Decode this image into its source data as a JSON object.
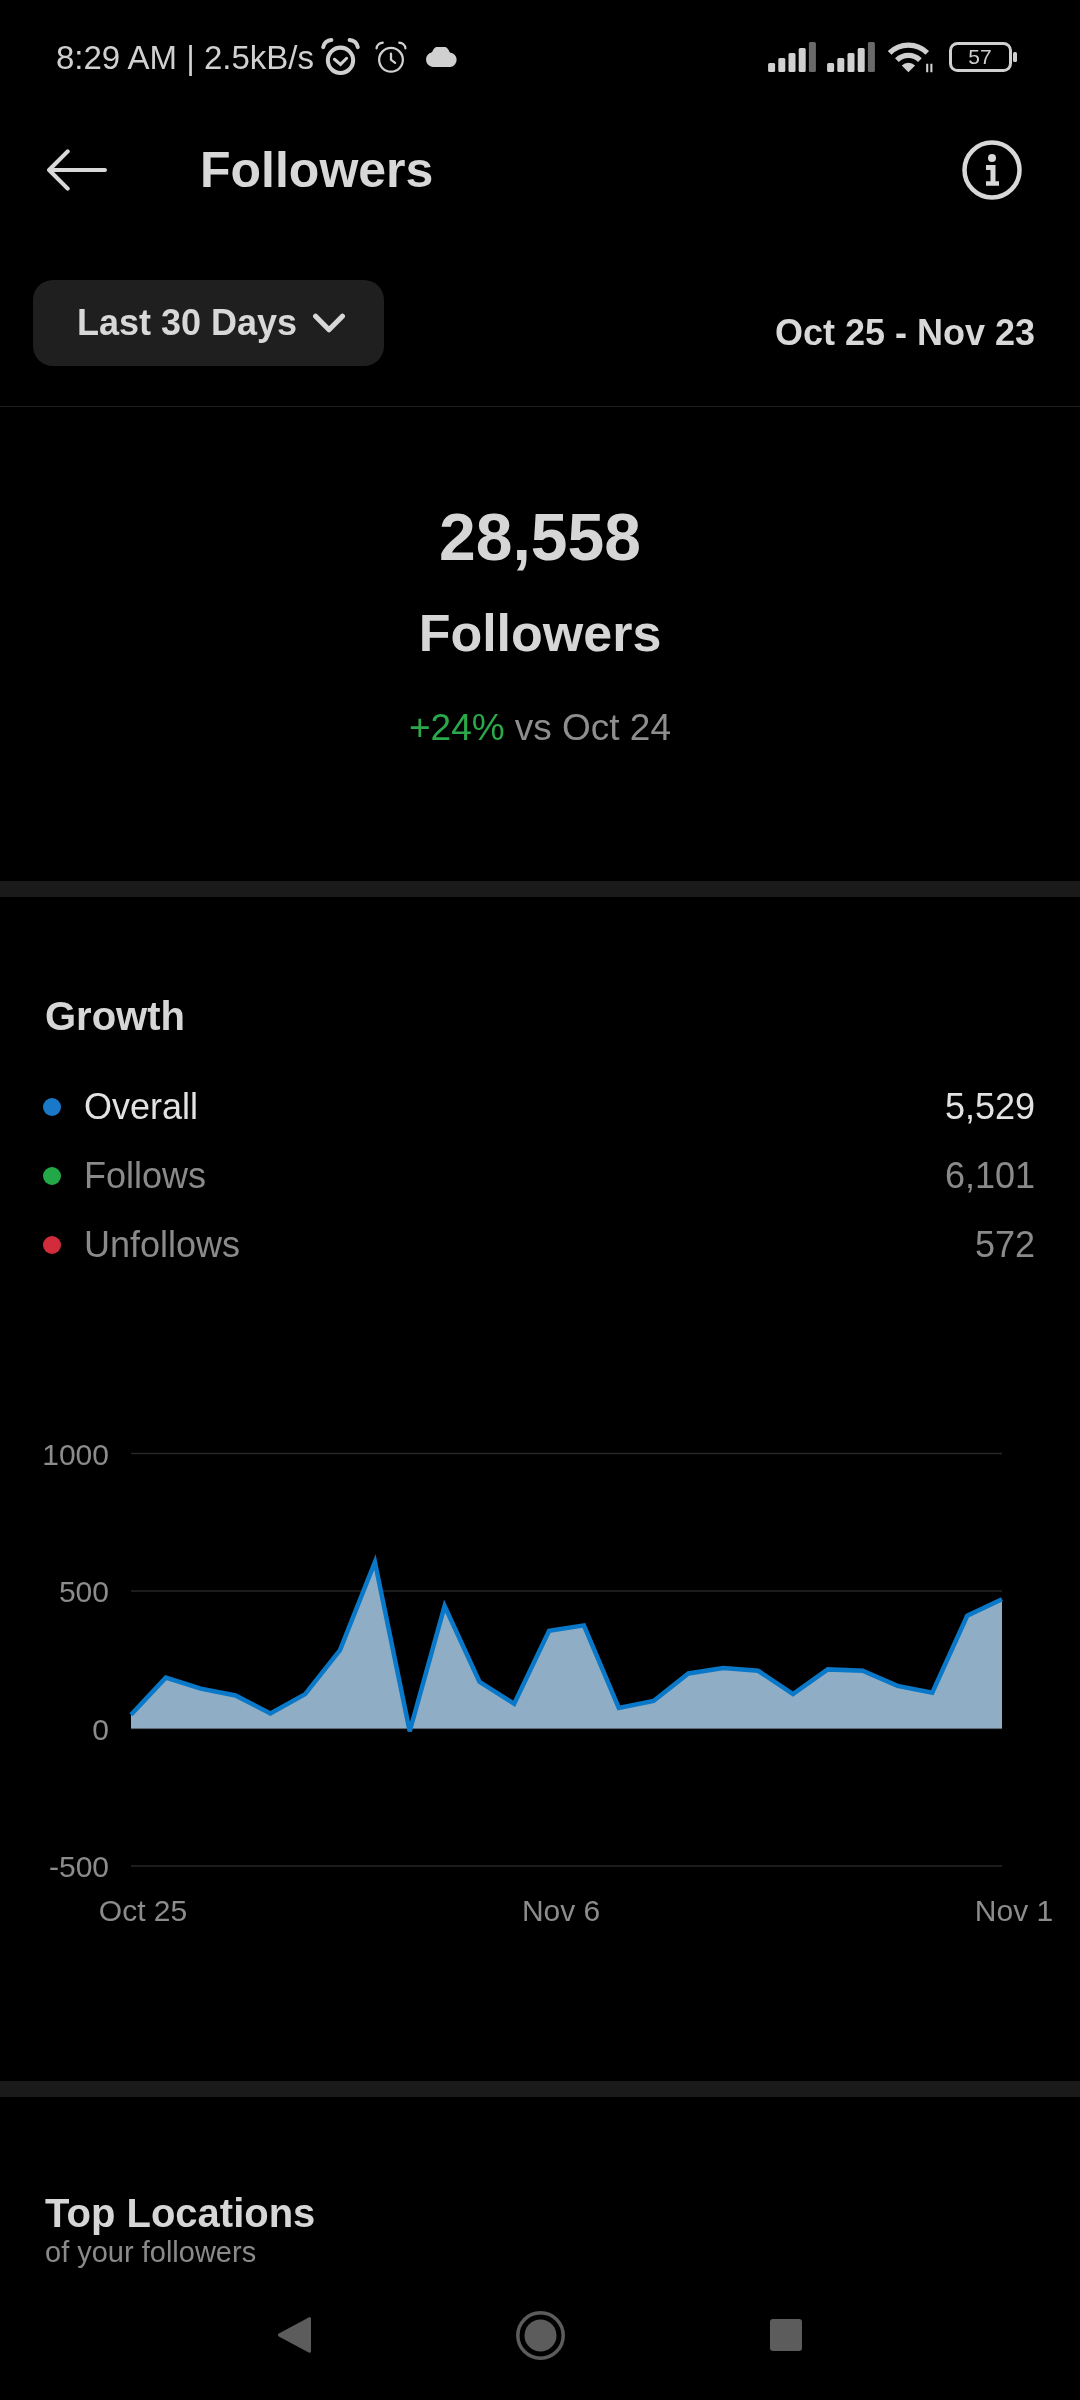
{
  "status_bar": {
    "time": "8:29 AM | 2.5kB/s",
    "battery": "57"
  },
  "header": {
    "title": "Followers"
  },
  "filter": {
    "range": "Last 30 Days",
    "dates": "Oct 25 - Nov 23"
  },
  "summary": {
    "count": "28,558",
    "label": "Followers",
    "change": "+24%",
    "comparison": "vs Oct 24"
  },
  "growth": {
    "title": "Growth",
    "legend": [
      {
        "label": "Overall",
        "value": "5,529",
        "color": "#1a78c8",
        "selected": true
      },
      {
        "label": "Follows",
        "value": "6,101",
        "color": "#22a847",
        "selected": false
      },
      {
        "label": "Unfollows",
        "value": "572",
        "color": "#d22b3b",
        "selected": false
      }
    ],
    "chart_data": {
      "type": "area",
      "categories": [
        "Oct 25",
        null,
        null,
        null,
        null,
        null,
        null,
        null,
        null,
        null,
        null,
        null,
        "Nov 6",
        null,
        null,
        null,
        null,
        null,
        null,
        null,
        null,
        null,
        null,
        null,
        null,
        "Nov 1"
      ],
      "ylim": [
        -500,
        1000
      ],
      "yticks": [
        -500,
        0,
        500,
        1000
      ],
      "series": [
        {
          "color": "#0a78c8",
          "values": [
            50,
            185,
            145,
            120,
            55,
            125,
            285,
            605,
            -10,
            445,
            170,
            90,
            355,
            375,
            75,
            100,
            200,
            220,
            210,
            125,
            215,
            210,
            155,
            130,
            410,
            470
          ]
        }
      ]
    }
  },
  "top_locations": {
    "title": "Top Locations",
    "subtitle": "of your followers"
  }
}
